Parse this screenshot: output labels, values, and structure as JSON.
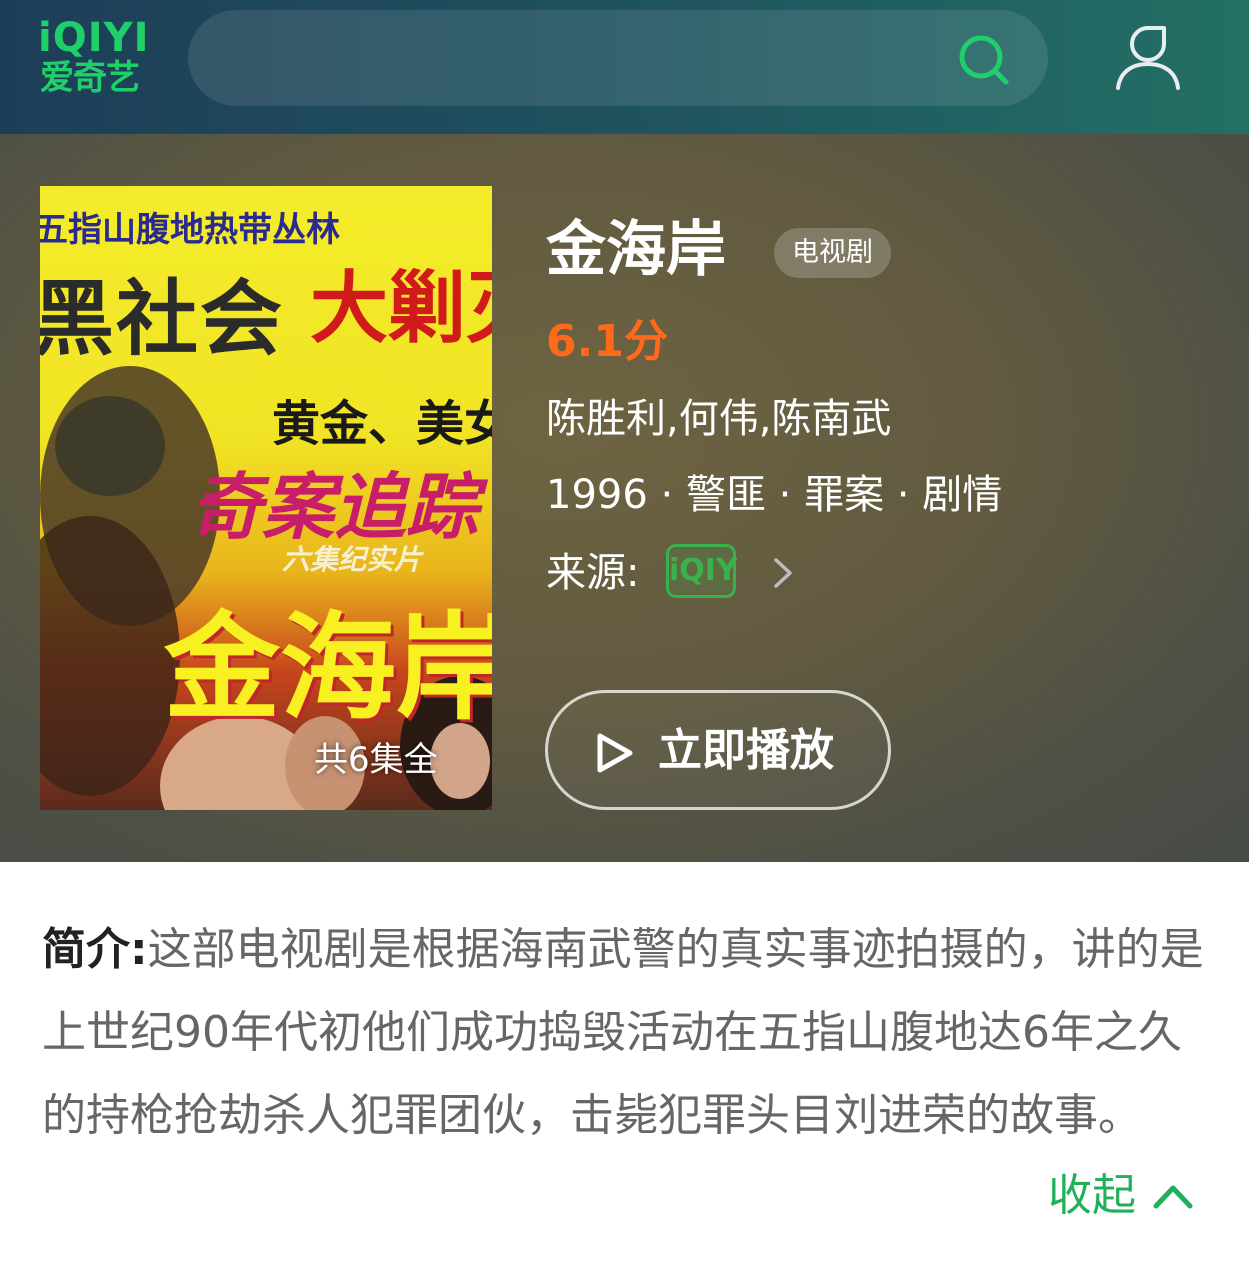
{
  "header": {
    "logo_en": "iQIYI",
    "logo_cn": "爱奇艺",
    "search_icon": "search-icon",
    "user_icon": "user-icon"
  },
  "poster": {
    "line1": "五指山腹地热带丛林",
    "line2": "黑社会",
    "line3": "大剿灭",
    "line4": "黄金、美女、凶",
    "line5": "奇案追踪",
    "line6": "六集纪实片",
    "line7": "金海岸",
    "episodes": "共6集全"
  },
  "show": {
    "title": "金海岸",
    "type": "电视剧",
    "score": "6.1分",
    "cast": "陈胜利,何伟,陈南武",
    "meta": "1996 · 警匪 · 罪案 · 剧情",
    "source_label": "来源:",
    "source_logo": "iQIY",
    "play_label": "立即播放"
  },
  "synopsis": {
    "label": "简介:",
    "text": "这部电视剧是根据海南武警的真实事迹拍摄的，讲的是上世纪90年代初他们成功捣毁活动在五指山腹地达6年之久的持枪抢劫杀人犯罪团伙，击毙犯罪头目刘进荣的故事。",
    "collapse_label": "收起"
  },
  "colors": {
    "brand_green": "#1fd06a",
    "score_orange": "#ff6a1a",
    "collapse_green": "#1fb05a"
  }
}
